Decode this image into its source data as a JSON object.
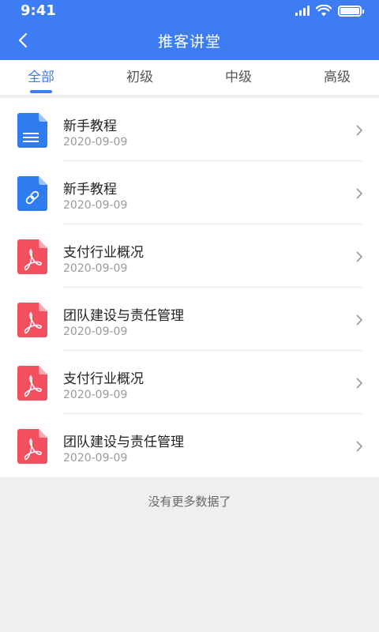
{
  "status_bar": {
    "time": "9:41"
  },
  "header": {
    "title": "推客讲堂"
  },
  "tabs": [
    {
      "label": "全部",
      "active": true
    },
    {
      "label": "初级",
      "active": false
    },
    {
      "label": "中级",
      "active": false
    },
    {
      "label": "高级",
      "active": false
    }
  ],
  "items": [
    {
      "title": "新手教程",
      "date": "2020-09-09",
      "icon": "document-icon",
      "icon_color": "#2f7bf0"
    },
    {
      "title": "新手教程",
      "date": "2020-09-09",
      "icon": "link-document-icon",
      "icon_color": "#2f7bf0"
    },
    {
      "title": "支付行业概况",
      "date": "2020-09-09",
      "icon": "pdf-icon",
      "icon_color": "#f3505f"
    },
    {
      "title": "团队建设与责任管理",
      "date": "2020-09-09",
      "icon": "pdf-icon",
      "icon_color": "#f3505f"
    },
    {
      "title": "支付行业概况",
      "date": "2020-09-09",
      "icon": "pdf-icon",
      "icon_color": "#f3505f"
    },
    {
      "title": "团队建设与责任管理",
      "date": "2020-09-09",
      "icon": "pdf-icon",
      "icon_color": "#f3505f"
    }
  ],
  "footer": {
    "no_more": "没有更多数据了"
  },
  "colors": {
    "accent": "#3d7cf3",
    "pdf": "#f3505f",
    "doc": "#2f7bf0"
  }
}
